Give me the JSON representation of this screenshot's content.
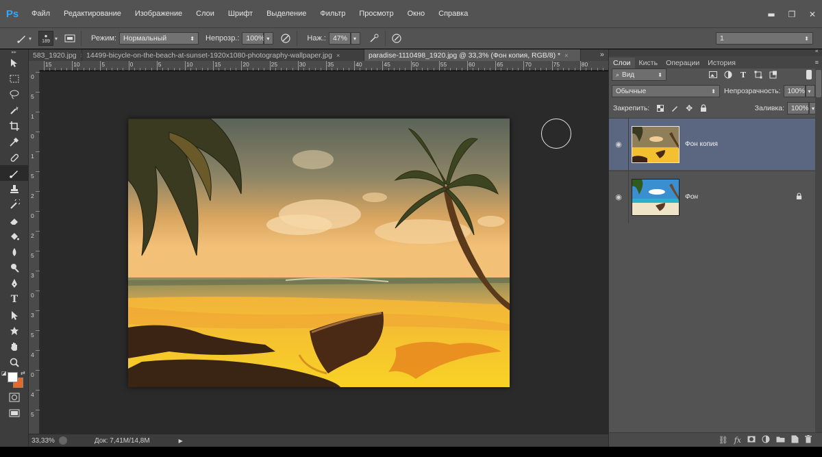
{
  "app": {
    "logo": "Ps"
  },
  "menu": [
    "Файл",
    "Редактирование",
    "Изображение",
    "Слои",
    "Шрифт",
    "Выделение",
    "Фильтр",
    "Просмотр",
    "Окно",
    "Справка"
  ],
  "window_buttons": {
    "minimize": "▬",
    "restore": "❐",
    "close": "✕"
  },
  "options": {
    "brush_size": "189",
    "mode_label": "Режим:",
    "mode_value": "Нормальный",
    "opacity_label": "Непрозр.:",
    "opacity_value": "100%",
    "pressure_label": "Наж.:",
    "pressure_value": "47%",
    "workspace_value": "1"
  },
  "tabs": [
    {
      "label": "583_1920.jpg",
      "close": "×"
    },
    {
      "label": "14499-bicycle-on-the-beach-at-sunset-1920x1080-photography-wallpaper.jpg",
      "close": "×"
    },
    {
      "label": "paradise-1110498_1920.jpg @ 33,3% (Фон копия, RGB/8) *",
      "close": "×"
    }
  ],
  "tab_overflow": "»",
  "ruler_top": [
    "15",
    "10",
    "5",
    "0",
    "5",
    "10",
    "15",
    "20",
    "25",
    "30",
    "35",
    "40",
    "45",
    "50",
    "55",
    "60",
    "65",
    "70",
    "75",
    "80"
  ],
  "ruler_left": [
    "0",
    "5",
    "1",
    "0",
    "1",
    "5",
    "2",
    "0",
    "2",
    "5",
    "3",
    "0",
    "3",
    "5",
    "4",
    "0",
    "4",
    "5"
  ],
  "status": {
    "zoom": "33,33%",
    "doc": "Док: 7,41M/14,8M"
  },
  "panel": {
    "collapse": "«",
    "tabs": [
      "Слои",
      "Кисть",
      "Операции",
      "История"
    ],
    "filter_label": "Вид",
    "blend_mode": "Обычные",
    "opacity_label": "Непрозрачность:",
    "opacity_value": "100%",
    "lock_label": "Закрепить:",
    "fill_label": "Заливка:",
    "fill_value": "100%"
  },
  "layers": [
    {
      "name": "Фон копия",
      "selected": true,
      "locked": false
    },
    {
      "name": "Фон",
      "selected": false,
      "locked": true
    }
  ],
  "colors": {
    "foreground": "#ffffff",
    "background": "#e26a2c",
    "selected_layer": "#5b6781",
    "ps_blue": "#31a8ff"
  }
}
